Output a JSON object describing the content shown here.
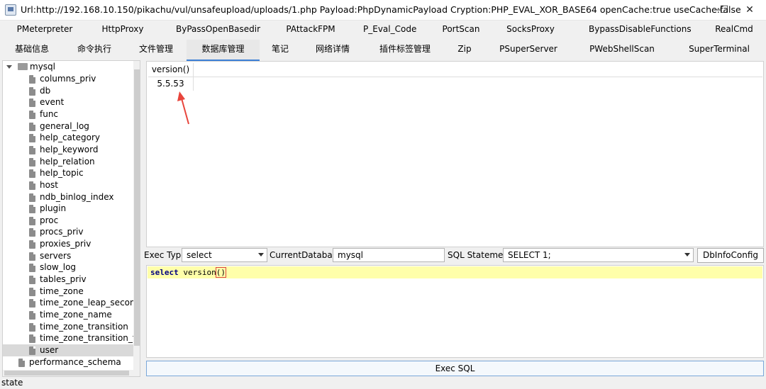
{
  "window": {
    "title": "Url:http://192.168.10.150/pikachu/vul/unsafeupload/uploads/1.php Payload:PhpDynamicPayload Cryption:PHP_EVAL_XOR_BASE64 openCache:true useCache:false",
    "minimize": "—",
    "maximize": "☐",
    "close": "✕"
  },
  "plugin_tabs": [
    "PMeterpreter",
    "HttpProxy",
    "ByPassOpenBasedir",
    "PAttackFPM",
    "P_Eval_Code",
    "PortScan",
    "SocksProxy",
    "BypassDisableFunctions",
    "RealCmd"
  ],
  "main_tabs": [
    "基础信息",
    "命令执行",
    "文件管理",
    "数据库管理",
    "笔记",
    "网络详情",
    "插件标签管理",
    "Zip",
    "PSuperServer",
    "PWebShellScan",
    "SuperTerminal"
  ],
  "active_main_tab": "数据库管理",
  "tree": {
    "root": "mysql",
    "tables": [
      "columns_priv",
      "db",
      "event",
      "func",
      "general_log",
      "help_category",
      "help_keyword",
      "help_relation",
      "help_topic",
      "host",
      "ndb_binlog_index",
      "plugin",
      "proc",
      "procs_priv",
      "proxies_priv",
      "servers",
      "slow_log",
      "tables_priv",
      "time_zone",
      "time_zone_leap_second",
      "time_zone_name",
      "time_zone_transition",
      "time_zone_transition_type",
      "user"
    ],
    "selected": "user",
    "next_database": "performance_schema"
  },
  "result": {
    "column": "version()",
    "value": "5.5.53"
  },
  "controls": {
    "exec_type_label": "Exec Type",
    "exec_type_value": "select",
    "current_db_label": "CurrentDatabase",
    "current_db_value": "mysql",
    "sql_statement_label": "SQL Statement",
    "sql_statement_value": "SELECT 1;",
    "dbinfo_button": "DbInfoConfig",
    "exec_button": "Exec SQL"
  },
  "editor": {
    "keyword": "select",
    "text": " version",
    "parens": "()"
  },
  "status": "state",
  "colors": {
    "accent_tab": "#3c7fd6",
    "editor_highlight": "#ffffaa",
    "annotation_arrow": "#e8453c"
  }
}
